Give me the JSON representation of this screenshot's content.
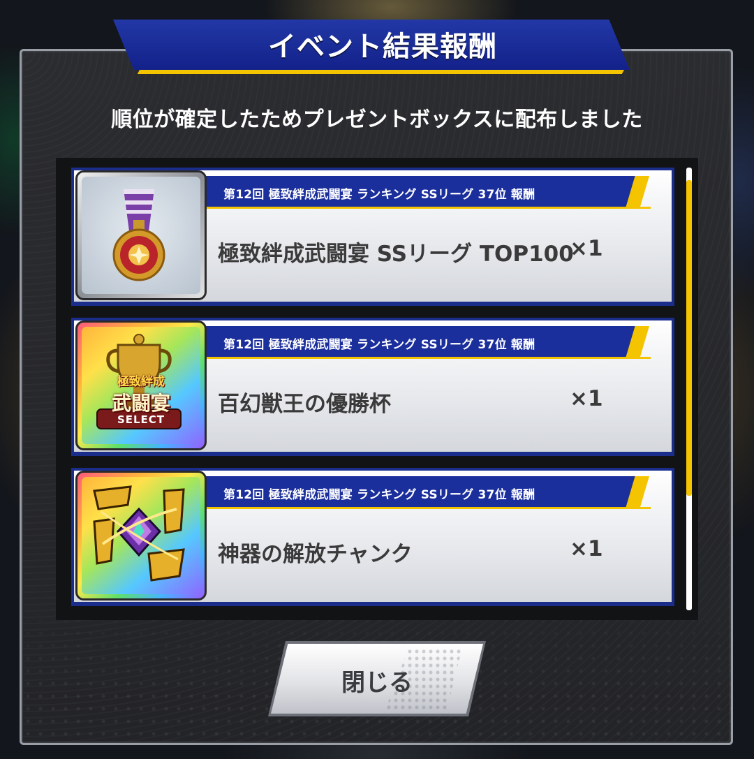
{
  "dialog": {
    "title": "イベント結果報酬",
    "subtitle": "順位が確定したためプレゼントボックスに配布しました",
    "close_label": "閉じる"
  },
  "rewards": [
    {
      "header": "第12回 極致絆成武闘宴 ランキング SSリーグ 37位 報酬",
      "name": "極致絆成武闘宴 SSリーグ TOP100",
      "quantity": "×1",
      "icon": "medal-icon",
      "frame": "silver"
    },
    {
      "header": "第12回 極致絆成武闘宴 ランキング SSリーグ 37位 報酬",
      "name": "百幻獣王の優勝杯",
      "quantity": "×1",
      "icon": "trophy-icon",
      "frame": "rainbow",
      "icon_text_top": "極致絆成",
      "icon_text_mid": "武闘宴",
      "icon_text_bottom": "SELECT"
    },
    {
      "header": "第12回 極致絆成武闘宴 ランキング SSリーグ 37位 報酬",
      "name": "神器の解放チャンク",
      "quantity": "×1",
      "icon": "chunk-icon",
      "frame": "rainbow"
    }
  ],
  "colors": {
    "banner_blue": "#1a2e9c",
    "accent_yellow": "#f5c400",
    "text_dark": "#3a3a3a"
  }
}
